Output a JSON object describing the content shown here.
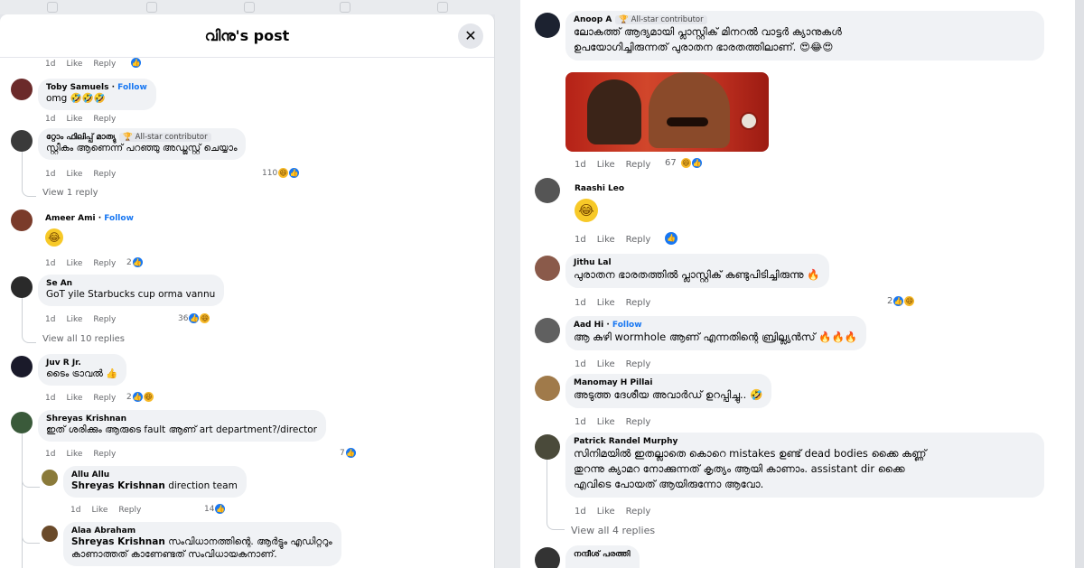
{
  "dialog": {
    "title": "വിനു's post",
    "close": "✕"
  },
  "actions": {
    "like": "Like",
    "reply": "Reply"
  },
  "left_comments": [
    {
      "time": "1d",
      "reactions": ""
    },
    {
      "name": "Toby Samuels",
      "follow": "Follow",
      "text": "omg 🤣🤣🤣",
      "time": "1d"
    },
    {
      "name": "റ്റോം ഫിലിപ്പ് മാത്യു",
      "badge": "All-star contributor",
      "text": "സ്റ്റീകം ആണെന്ന് പറഞ്ഞു അഡ്ജസ്റ്റ് ചെയ്യാം",
      "time": "1d",
      "reactions": "110",
      "more": "View 1 reply"
    },
    {
      "name": "Ameer Ami",
      "follow": "Follow",
      "text": "😂",
      "time": "1d",
      "reactions": "2"
    },
    {
      "name": "Se An",
      "text": "GoT yile Starbucks cup orma vannu",
      "time": "1d",
      "reactions": "36",
      "more": "View all 10 replies"
    },
    {
      "name": "Juv R Jr.",
      "text": "ടൈം ട്രാവൽ 👍",
      "time": "1d",
      "reactions": "2"
    },
    {
      "name": "Shreyas Krishnan",
      "text": "ഇത് ശരിക്കും ആരുടെ fault ആണ് art department?/director",
      "time": "1d",
      "reactions": "7"
    },
    {
      "name": "Allu Allu",
      "tag": "Shreyas Krishnan",
      "text": "direction team",
      "time": "1d",
      "reactions": "14"
    },
    {
      "name": "Alaa Abraham",
      "tag": "Shreyas Krishnan",
      "text": "സംവിധാനത്തിന്റെ. ആർട്ടും എഡിറ്ററും",
      "text2": "കാണാത്തത് കാണേണ്ടത് സംവിധായകനാണ്."
    }
  ],
  "right_comments": [
    {
      "name": "Anoop A",
      "badge": "All-star contributor",
      "text": "ലോകത്ത് ആദ്യമായി പ്ലാസ്റ്റിക് മിനറൽ വാട്ടർ ക്യാനുകൾ",
      "text2": "ഉപയോഗിച്ചിരുന്നത് പുരാതന ഭാരതത്തിലാണ്. 😍😂😍",
      "time": "1d",
      "reactions": "67"
    },
    {
      "name": "Raashi Leo",
      "text": "😂",
      "time": "1d"
    },
    {
      "name": "Jithu Lal",
      "text": "പുരാതന ഭാരതത്തിൽ പ്ലാസ്റ്റിക് കണ്ടുപിടിച്ചിരുന്നു 🔥",
      "time": "1d",
      "reactions": "2"
    },
    {
      "name": "Aad Hi",
      "follow": "Follow",
      "text": "ആ കുഴി wormhole ആണ് എന്നതിന്റെ ബ്രില്ല്യൻസ് 🔥🔥🔥",
      "time": "1d"
    },
    {
      "name": "Manomay H Pillai",
      "text": "അടുത്ത ദേശീയ അവാർഡ് ഉറപ്പിച്ചു.. 🤣",
      "time": "1d"
    },
    {
      "name": "Patrick Randel Murphy",
      "text": "സിനിമയിൽ ഇതല്ലാതെ കൊറെ mistakes ഉണ്ട് dead bodies ക്കൈ കണ്ണ്",
      "text2": "തുറന്നു ക്യാമറ നോക്കുന്നത് കൃത്യം ആയി കാണാം. assistant dir ക്കൈ",
      "text3": "എവിടെ പോയത് ആയിരുന്നോ ആവോ.",
      "time": "1d",
      "more": "View all 4 replies"
    },
    {
      "name": "നന്ദീശ് പരത്തി"
    }
  ]
}
